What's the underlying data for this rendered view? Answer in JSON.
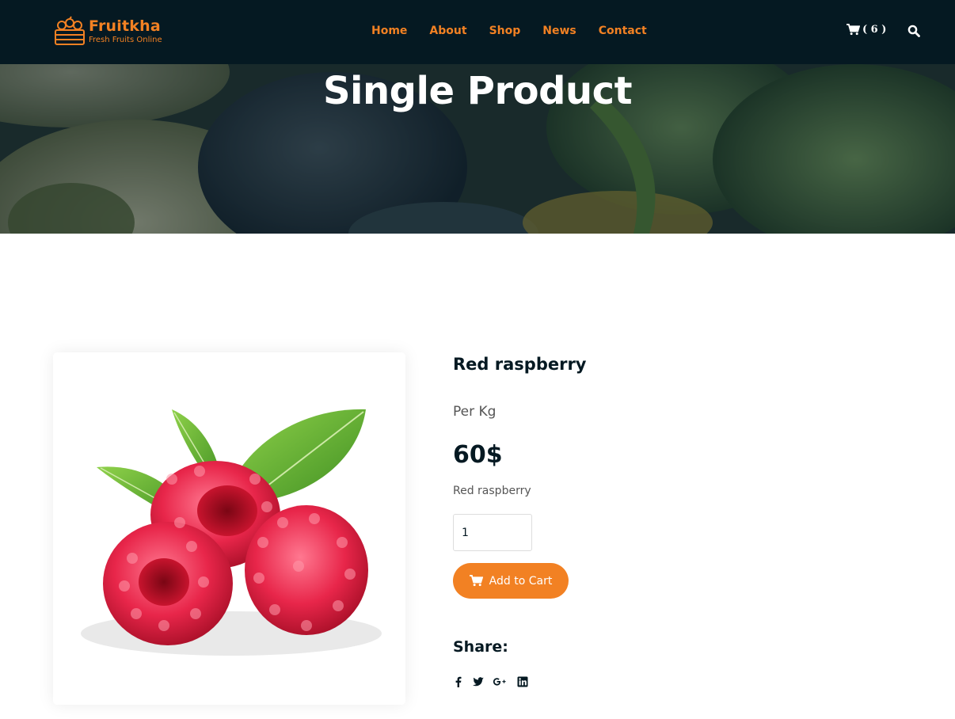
{
  "brand": {
    "name": "Fruitkha",
    "tagline": "Fresh Fruits Online",
    "accent": "#F28123",
    "dark": "#051922"
  },
  "nav": {
    "items": [
      {
        "label": "Home"
      },
      {
        "label": "About"
      },
      {
        "label": "Shop"
      },
      {
        "label": "News"
      },
      {
        "label": "Contact"
      }
    ],
    "cart_count": "( 6 )",
    "cart_icon": "shopping-cart-icon",
    "search_icon": "search-icon"
  },
  "hero": {
    "title": "Single Product"
  },
  "product": {
    "name": "Red raspberry",
    "unit": "Per Kg",
    "price": "60$",
    "description": "Red raspberry",
    "quantity": "1",
    "add_to_cart_label": "Add to Cart",
    "share_label": "Share:",
    "share_icons": [
      "facebook-icon",
      "twitter-icon",
      "google-plus-icon",
      "linkedin-icon"
    ]
  }
}
